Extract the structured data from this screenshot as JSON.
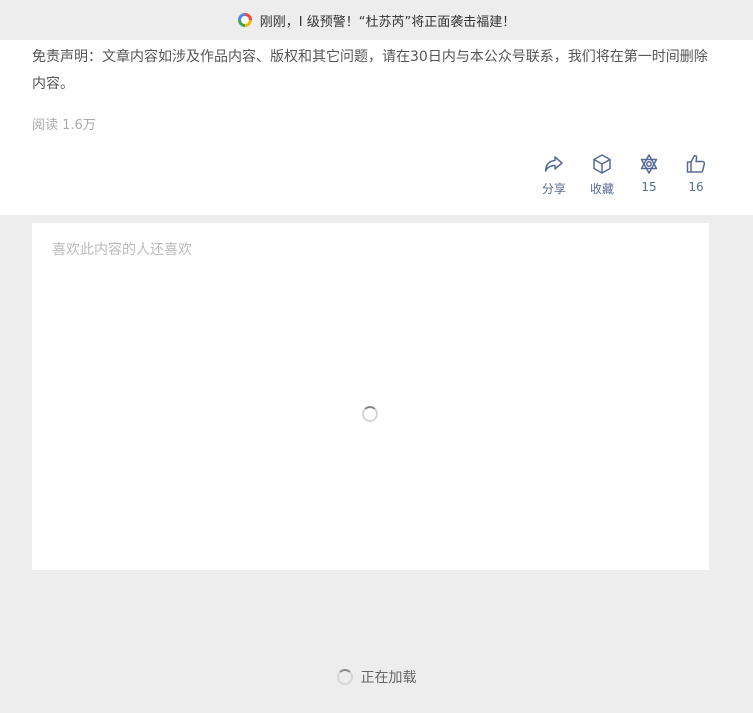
{
  "topbar": {
    "headline": "刚刚，Ⅰ 级预警！“杜苏芮”将正面袭击福建！",
    "logo_icon": "colorful-circle-logo"
  },
  "article": {
    "disclaimer": "免责声明：文章内容如涉及作品内容、版权和其它问题，请在30日内与本公众号联系，我们将在第一时间删除内容。",
    "read_count": "阅读 1.6万"
  },
  "actions": {
    "share_label": "分享",
    "favorite_label": "收藏",
    "flower_count": "15",
    "like_count": "16",
    "accent_color": "#576b95"
  },
  "recommend": {
    "title": "喜欢此内容的人还喜欢"
  },
  "footer": {
    "loading_text": "正在加载"
  }
}
